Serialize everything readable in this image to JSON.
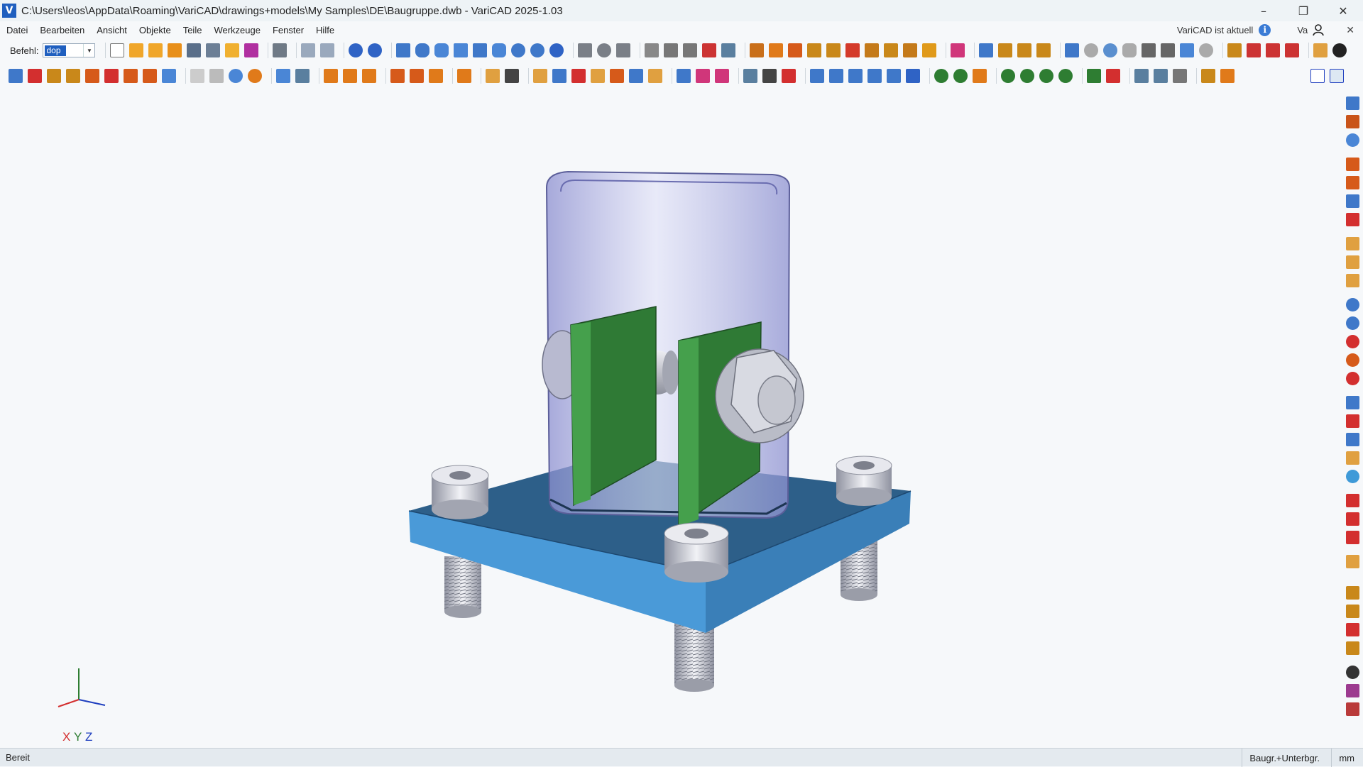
{
  "window": {
    "title": "C:\\Users\\leos\\AppData\\Roaming\\VariCAD\\drawings+models\\My Samples\\DE\\Baugruppe.dwb - VariCAD 2025-1.03",
    "app_icon_letter": "V",
    "controls": {
      "minimize": "–",
      "restore": "❐",
      "close": "✕"
    }
  },
  "menu": {
    "items": [
      "Datei",
      "Bearbeiten",
      "Ansicht",
      "Objekte",
      "Teile",
      "Werkzeuge",
      "Fenster",
      "Hilfe"
    ],
    "update_status": "VariCAD ist aktuell",
    "info_icon": "i",
    "user_label": "Va",
    "panel_close": "✕"
  },
  "command": {
    "label": "Befehl:",
    "value": "dop",
    "dropdown": "▼"
  },
  "viewport": {
    "axes_label": {
      "x": "X",
      "y": "Y",
      "z": "Z"
    },
    "colors": {
      "background": "#f6f8fa",
      "base_plate_top": "#2d5f89",
      "base_plate_front": "#4a9ad8",
      "base_plate_side": "#3a7fb8",
      "tube": "#9a9fd6",
      "bracket": "#2f7a35",
      "bolt": "#c7c9d2",
      "axis_x": "#d32f2f",
      "axis_y": "#2e7d32",
      "axis_z": "#1f3fbf"
    }
  },
  "status": {
    "left": "Bereit",
    "mode": "Baugr.+Unterbgr.",
    "units": "mm"
  }
}
